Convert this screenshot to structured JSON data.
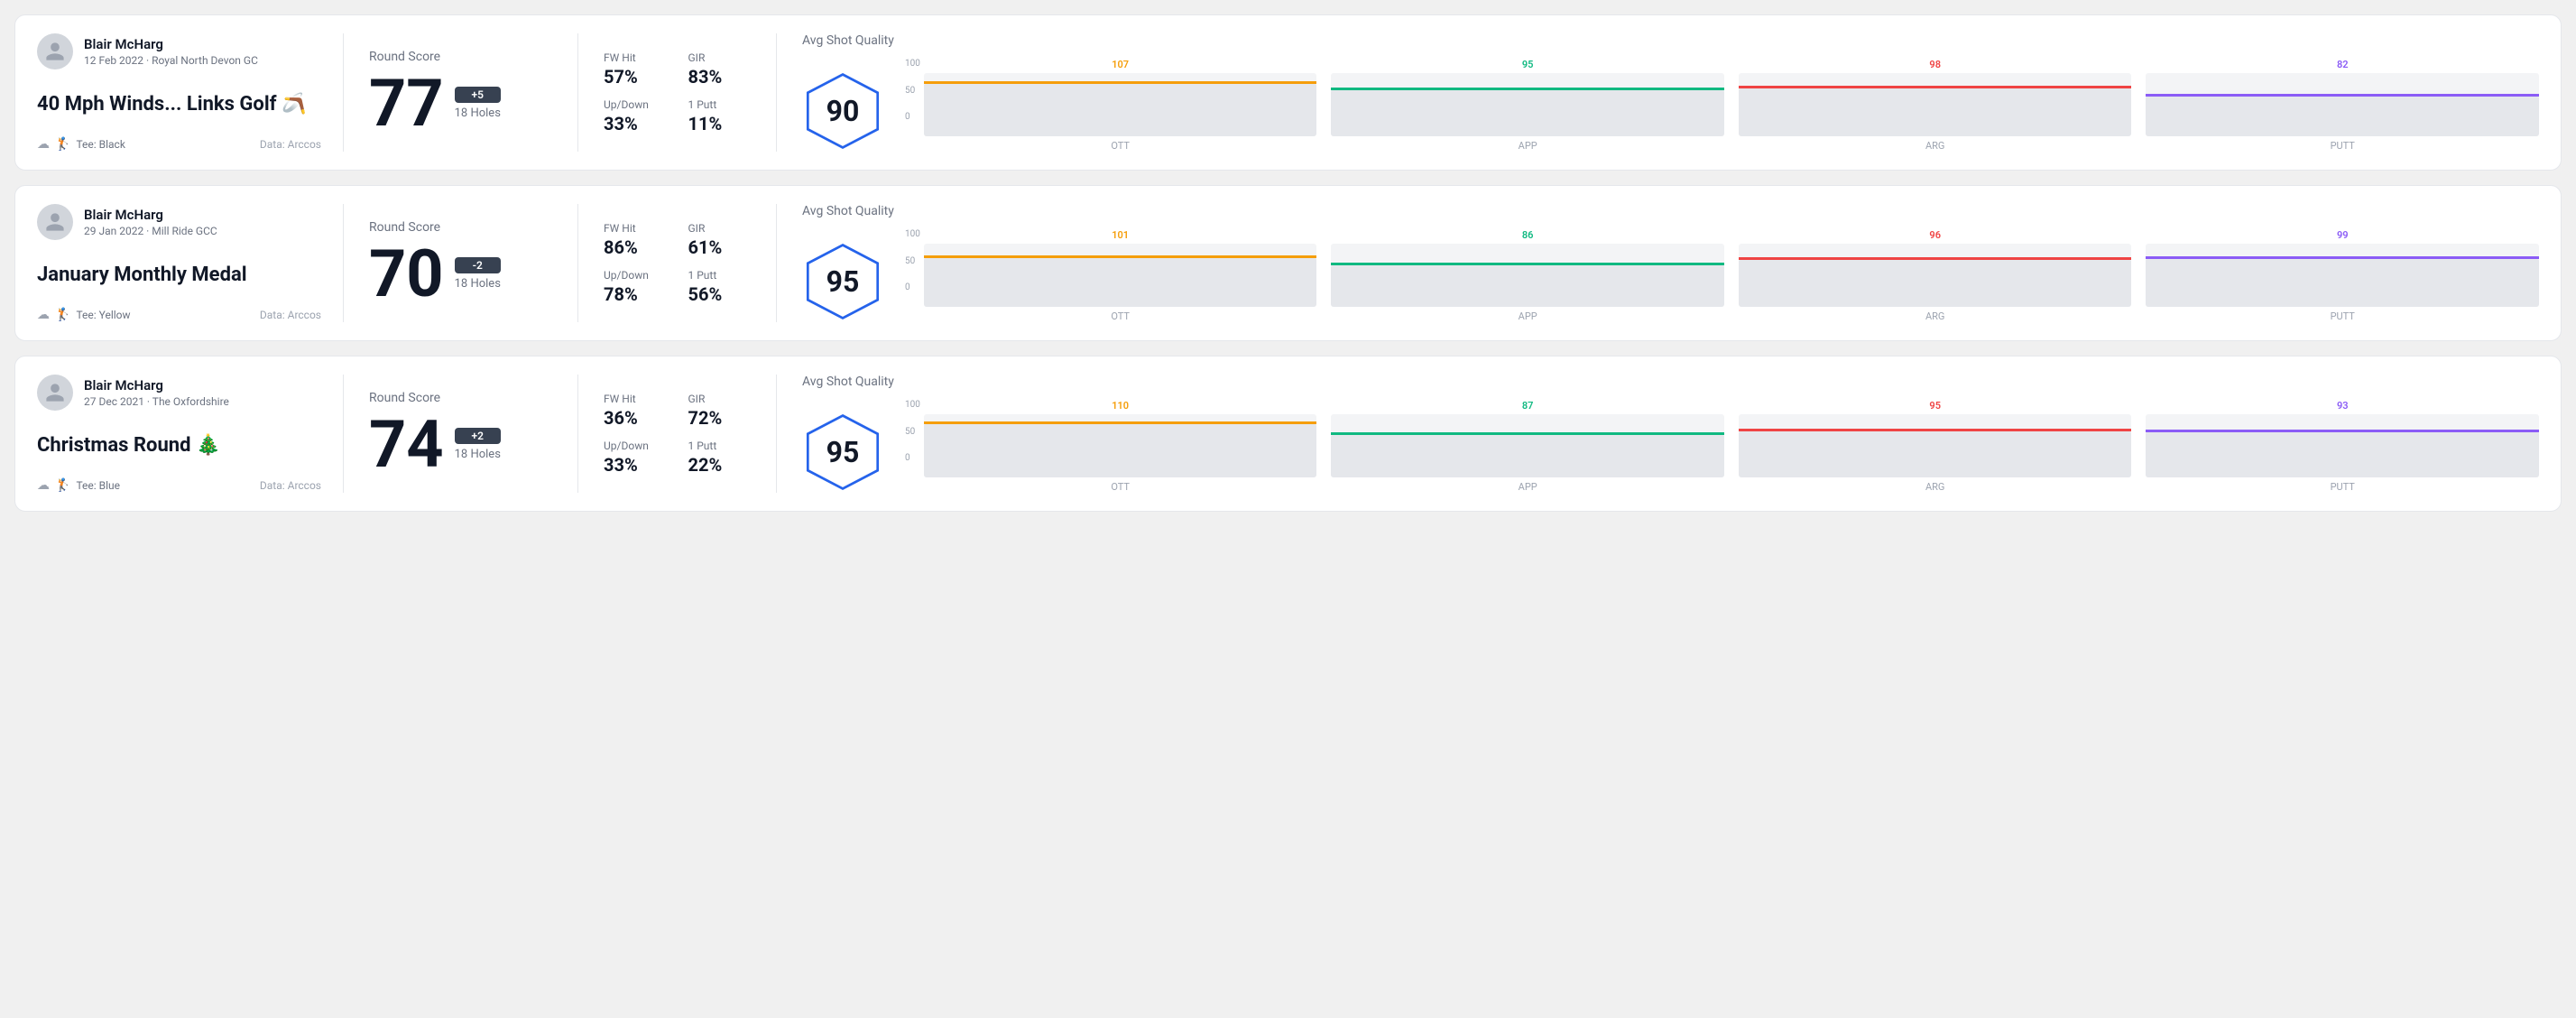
{
  "cards": [
    {
      "id": "card1",
      "user": {
        "name": "Blair McHarg",
        "date": "12 Feb 2022",
        "course": "Royal North Devon GC"
      },
      "title": "40 Mph Winds... Links Golf 🪃",
      "tee": "Black",
      "dataSource": "Data: Arccos",
      "roundScore": {
        "label": "Round Score",
        "score": "77",
        "badge": "+5",
        "holes": "18 Holes"
      },
      "stats": {
        "fwHitLabel": "FW Hit",
        "fwHitValue": "57%",
        "girLabel": "GIR",
        "girValue": "83%",
        "upDownLabel": "Up/Down",
        "upDownValue": "33%",
        "onePuttLabel": "1 Putt",
        "onePuttValue": "11%"
      },
      "avgShotQuality": {
        "label": "Avg Shot Quality",
        "score": "90",
        "bars": [
          {
            "label": "OTT",
            "value": 107,
            "color": "#f59e0b",
            "fillHeight": 70
          },
          {
            "label": "APP",
            "value": 95,
            "color": "#10b981",
            "fillHeight": 62
          },
          {
            "label": "ARG",
            "value": 98,
            "color": "#ef4444",
            "fillHeight": 64
          },
          {
            "label": "PUTT",
            "value": 82,
            "color": "#8b5cf6",
            "fillHeight": 54
          }
        ]
      }
    },
    {
      "id": "card2",
      "user": {
        "name": "Blair McHarg",
        "date": "29 Jan 2022",
        "course": "Mill Ride GCC"
      },
      "title": "January Monthly Medal",
      "tee": "Yellow",
      "dataSource": "Data: Arccos",
      "roundScore": {
        "label": "Round Score",
        "score": "70",
        "badge": "-2",
        "holes": "18 Holes"
      },
      "stats": {
        "fwHitLabel": "FW Hit",
        "fwHitValue": "86%",
        "girLabel": "GIR",
        "girValue": "61%",
        "upDownLabel": "Up/Down",
        "upDownValue": "78%",
        "onePuttLabel": "1 Putt",
        "onePuttValue": "56%"
      },
      "avgShotQuality": {
        "label": "Avg Shot Quality",
        "score": "95",
        "bars": [
          {
            "label": "OTT",
            "value": 101,
            "color": "#f59e0b",
            "fillHeight": 70
          },
          {
            "label": "APP",
            "value": 86,
            "color": "#10b981",
            "fillHeight": 56
          },
          {
            "label": "ARG",
            "value": 96,
            "color": "#ef4444",
            "fillHeight": 63
          },
          {
            "label": "PUTT",
            "value": 99,
            "color": "#8b5cf6",
            "fillHeight": 65
          }
        ]
      }
    },
    {
      "id": "card3",
      "user": {
        "name": "Blair McHarg",
        "date": "27 Dec 2021",
        "course": "The Oxfordshire"
      },
      "title": "Christmas Round 🎄",
      "tee": "Blue",
      "dataSource": "Data: Arccos",
      "roundScore": {
        "label": "Round Score",
        "score": "74",
        "badge": "+2",
        "holes": "18 Holes"
      },
      "stats": {
        "fwHitLabel": "FW Hit",
        "fwHitValue": "36%",
        "girLabel": "GIR",
        "girValue": "72%",
        "upDownLabel": "Up/Down",
        "upDownValue": "33%",
        "onePuttLabel": "1 Putt",
        "onePuttValue": "22%"
      },
      "avgShotQuality": {
        "label": "Avg Shot Quality",
        "score": "95",
        "bars": [
          {
            "label": "OTT",
            "value": 110,
            "color": "#f59e0b",
            "fillHeight": 70
          },
          {
            "label": "APP",
            "value": 87,
            "color": "#10b981",
            "fillHeight": 57
          },
          {
            "label": "ARG",
            "value": 95,
            "color": "#ef4444",
            "fillHeight": 62
          },
          {
            "label": "PUTT",
            "value": 93,
            "color": "#8b5cf6",
            "fillHeight": 61
          }
        ]
      }
    }
  ],
  "yAxisLabels": [
    "100",
    "50",
    "0"
  ]
}
